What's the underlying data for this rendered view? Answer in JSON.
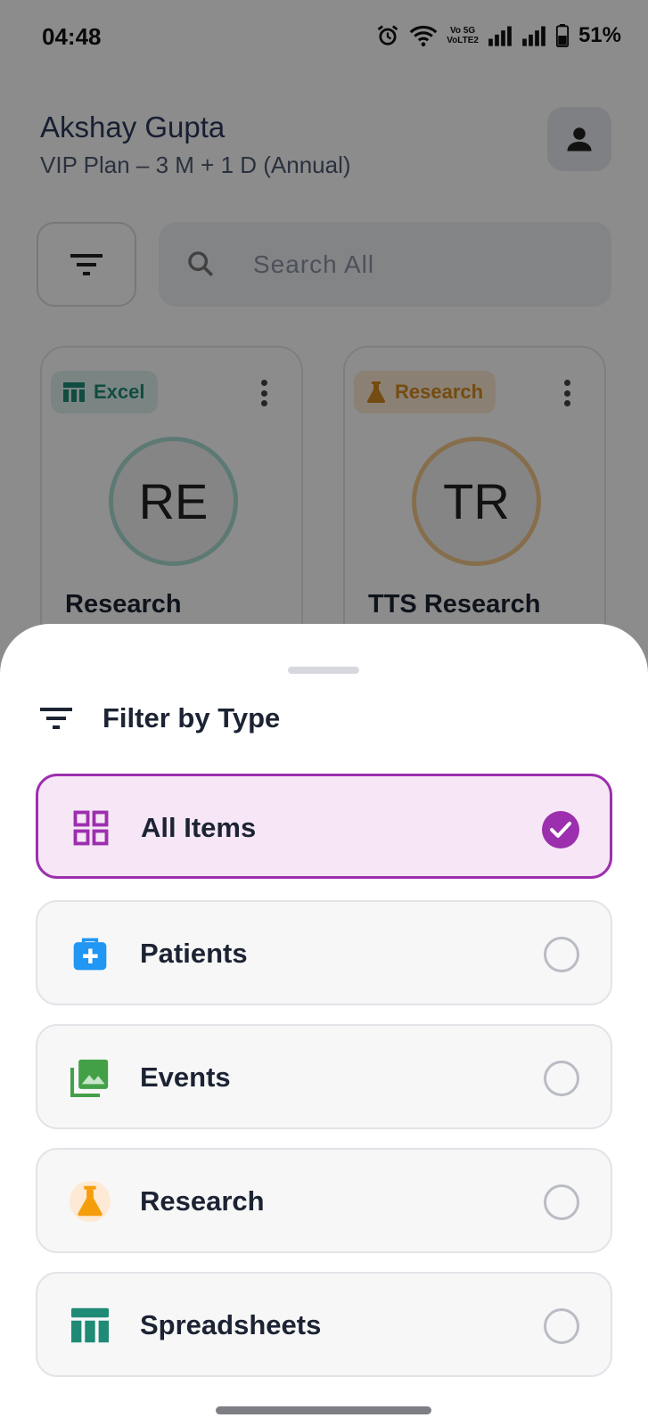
{
  "status_bar": {
    "time": "04:48",
    "network_label": "Vo 5G\nVoLTE2",
    "battery": "51%",
    "icons": [
      "alarm-icon",
      "wifi-icon",
      "signal-icon",
      "signal-icon",
      "battery-icon"
    ]
  },
  "header": {
    "user_name": "Akshay Gupta",
    "plan": "VIP Plan – 3 M + 1 D (Annual)"
  },
  "search": {
    "placeholder": "Search All"
  },
  "cards": [
    {
      "chip_label": "Excel",
      "chip_icon": "spreadsheet-icon",
      "initials": "RE",
      "title": "Research"
    },
    {
      "chip_label": "Research",
      "chip_icon": "flask-icon",
      "initials": "TR",
      "title": "TTS Research"
    }
  ],
  "filter_sheet": {
    "title": "Filter by Type",
    "options": [
      {
        "label": "All Items",
        "icon": "grid-icon",
        "selected": true
      },
      {
        "label": "Patients",
        "icon": "medical-kit-icon",
        "selected": false
      },
      {
        "label": "Events",
        "icon": "gallery-icon",
        "selected": false
      },
      {
        "label": "Research",
        "icon": "flask-icon",
        "selected": false
      },
      {
        "label": "Spreadsheets",
        "icon": "spreadsheet-icon",
        "selected": false
      }
    ]
  },
  "colors": {
    "accent": "#9c2fae",
    "selected_bg": "#f6e6f6",
    "excel_green": "#1f8a76",
    "research_orange": "#d48a1f",
    "patients_blue": "#2196f3",
    "events_green": "#43a047"
  }
}
